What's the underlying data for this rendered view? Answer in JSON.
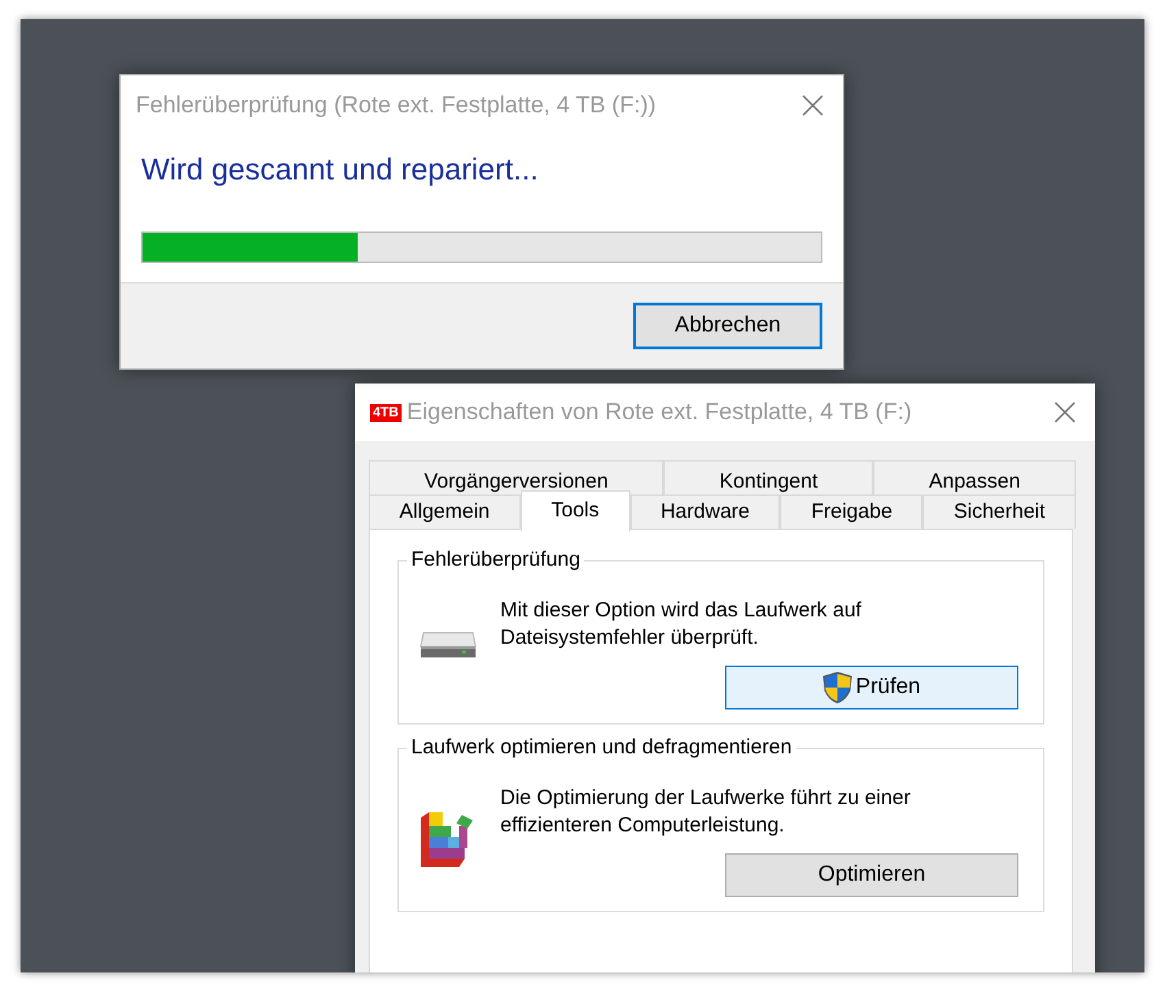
{
  "scan_dialog": {
    "title": "Fehlerüberprüfung (Rote ext. Festplatte, 4 TB (F:))",
    "heading": "Wird gescannt und repariert...",
    "progress": {
      "level": 0.317
    },
    "buttons": [
      {
        "label": "Abbrechen",
        "focused": true
      }
    ]
  },
  "properties_window": {
    "badge": "4TB",
    "title": "Eigenschaften von Rote ext. Festplatte, 4 TB (F:)",
    "tab_rows": [
      [
        {
          "label": "Vorgängerversionen",
          "selected": false
        },
        {
          "label": "Kontingent",
          "selected": false
        },
        {
          "label": "Anpassen",
          "selected": false
        }
      ],
      [
        {
          "label": "Allgemein",
          "selected": false
        },
        {
          "label": "Tools",
          "selected": true
        },
        {
          "label": "Hardware",
          "selected": false
        },
        {
          "label": "Freigabe",
          "selected": false
        },
        {
          "label": "Sicherheit",
          "selected": false
        }
      ]
    ],
    "groups": [
      {
        "title": "Fehlerüberprüfung",
        "kind": "drive",
        "text": "Mit dieser Option wird das Laufwerk auf Dateisystemfehler überprüft.",
        "button": {
          "label": "Prüfen",
          "shield": true,
          "hovered": true
        }
      },
      {
        "title": "Laufwerk optimieren und defragmentieren",
        "kind": "defrag",
        "text": "Die Optimierung der Laufwerke führt zu einer effizienteren Computerleistung.",
        "button": {
          "label": "Optimieren",
          "shield": false,
          "hovered": false
        }
      }
    ]
  }
}
